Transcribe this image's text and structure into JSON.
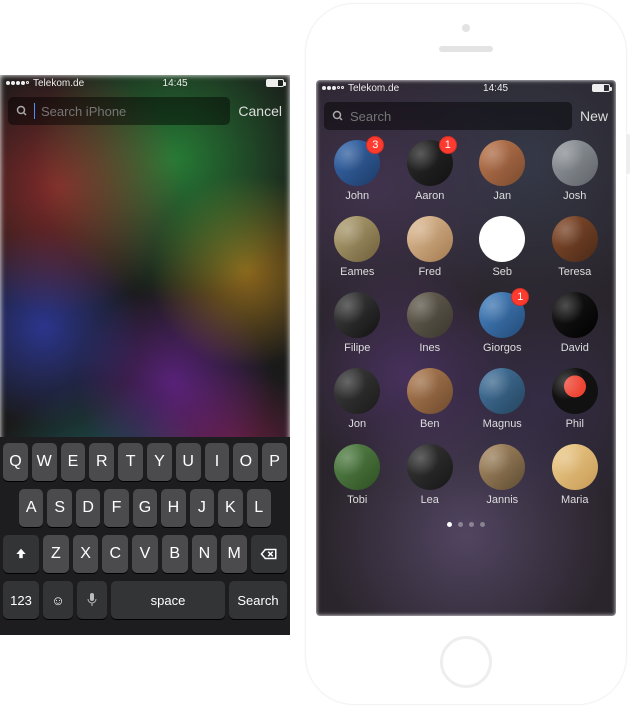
{
  "left": {
    "status": {
      "carrier": "Telekom.de",
      "time": "14:45"
    },
    "search": {
      "placeholder": "Search iPhone",
      "cancel": "Cancel"
    },
    "keys": {
      "row1": [
        "Q",
        "W",
        "E",
        "R",
        "T",
        "Y",
        "U",
        "I",
        "O",
        "P"
      ],
      "row2": [
        "A",
        "S",
        "D",
        "F",
        "G",
        "H",
        "J",
        "K",
        "L"
      ],
      "row3": [
        "Z",
        "X",
        "C",
        "V",
        "B",
        "N",
        "M"
      ],
      "num": "123",
      "space": "space",
      "search": "Search"
    }
  },
  "right": {
    "status": {
      "carrier": "Telekom.de",
      "time": "14:45"
    },
    "search": {
      "placeholder": "Search",
      "newLabel": "New"
    },
    "people": [
      {
        "name": "John",
        "badge": 3,
        "c": 0
      },
      {
        "name": "Aaron",
        "badge": 1,
        "c": 1
      },
      {
        "name": "Jan",
        "badge": null,
        "c": 2
      },
      {
        "name": "Josh",
        "badge": null,
        "c": 3
      },
      {
        "name": "Eames",
        "badge": null,
        "c": 4
      },
      {
        "name": "Fred",
        "badge": null,
        "c": 5
      },
      {
        "name": "Seb",
        "badge": null,
        "c": 6
      },
      {
        "name": "Teresa",
        "badge": null,
        "c": 7
      },
      {
        "name": "Filipe",
        "badge": null,
        "c": 8
      },
      {
        "name": "Ines",
        "badge": null,
        "c": 9
      },
      {
        "name": "Giorgos",
        "badge": 1,
        "c": 10
      },
      {
        "name": "David",
        "badge": null,
        "c": 11
      },
      {
        "name": "Jon",
        "badge": null,
        "c": 12
      },
      {
        "name": "Ben",
        "badge": null,
        "c": 13
      },
      {
        "name": "Magnus",
        "badge": null,
        "c": 14
      },
      {
        "name": "Phil",
        "badge": null,
        "c": 15
      },
      {
        "name": "Tobi",
        "badge": null,
        "c": 16
      },
      {
        "name": "Lea",
        "badge": null,
        "c": 17
      },
      {
        "name": "Jannis",
        "badge": null,
        "c": 18
      },
      {
        "name": "Maria",
        "badge": null,
        "c": 19
      }
    ],
    "pager": {
      "count": 4,
      "active": 0
    }
  }
}
